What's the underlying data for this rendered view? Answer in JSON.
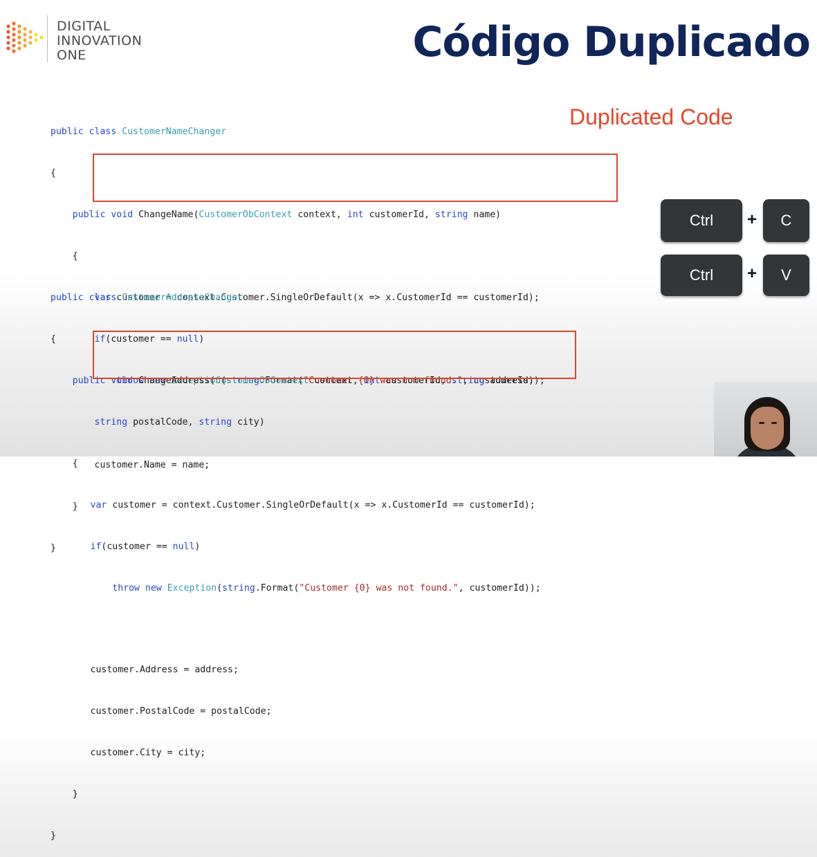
{
  "brand": {
    "line1": "DIGITAL",
    "line2": "INNOVATION",
    "line3": "ONE",
    "colors": [
      "#f05a28",
      "#f7941d",
      "#fbb040",
      "#fdd835"
    ]
  },
  "title": "Código Duplicado",
  "subtitle": "Duplicated Code",
  "code_block_1": [
    "public class CustomerNameChanger",
    "{",
    "    public void ChangeName(CustomerObContext context, int customerId, string name)",
    "    {",
    "        var customer = context.Customer.SingleOrDefault(x => x.CustomerId == customerId);",
    "        if(customer == null)",
    "            throw new Exception(string.Format(\"Customer {0} was not found.\", customerId));",
    "",
    "        customer.Name = name;",
    "    }",
    "}"
  ],
  "code_block_2": [
    "public class CustomerAddressChanger",
    "{",
    "    public void ChangeAddress(CustomerObContext context, int customerId, string address,",
    "        string postalCode, string city)",
    "    {",
    "        var customer = context.Customer.SingleOrDefault(x => x.CustomerId == customerId);",
    "        if(customer == null)",
    "            throw new Exception(string.Format(\"Customer {0} was not found.\", customerId));",
    "",
    "        customer.Address = address;",
    "        customer.PostalCode = postalCode;",
    "        customer.City = city;",
    "    }",
    "}"
  ],
  "shortcuts": {
    "copy": {
      "modifier": "Ctrl",
      "plus": "+",
      "key": "C"
    },
    "paste": {
      "modifier": "Ctrl",
      "plus": "+",
      "key": "V"
    }
  },
  "colors": {
    "title": "#10255a",
    "subtitle": "#e8452a",
    "highlight_border": "#d8462c",
    "keycap": "#333638",
    "keyword": "#2848c8",
    "type": "#3a9fb0",
    "string": "#a52a2a"
  }
}
